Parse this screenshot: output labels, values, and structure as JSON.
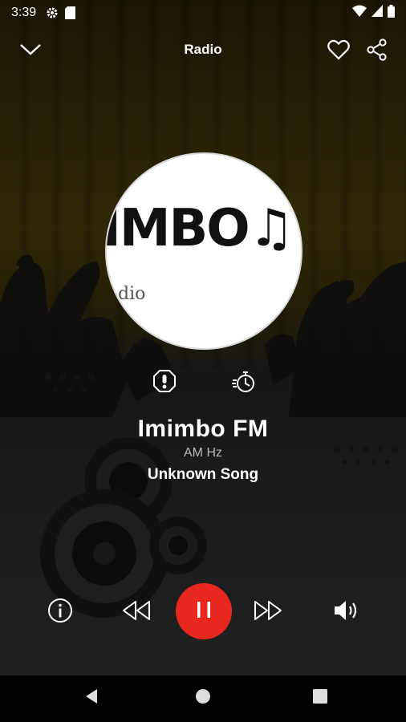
{
  "status_bar": {
    "time": "3:39",
    "icons": [
      "settings-icon",
      "sd-card-icon",
      "wifi-icon",
      "signal-icon",
      "battery-icon"
    ]
  },
  "app_bar": {
    "title": "Radio",
    "icons": [
      "chevron-down-icon",
      "heart-icon",
      "share-icon"
    ]
  },
  "artwork": {
    "logo_text": "IMBO♫",
    "logo_subtext": "dio"
  },
  "actions": {
    "icons": [
      "report-icon",
      "sleep-timer-icon"
    ]
  },
  "now_playing": {
    "station": "Imimbo FM",
    "frequency": "AM Hz",
    "song": "Unknown Song"
  },
  "controls": {
    "icons": [
      "info-icon",
      "rewind-icon",
      "pause-icon",
      "fast-forward-icon",
      "volume-icon"
    ],
    "play_button_color": "#e8271f"
  },
  "nav_bar": {
    "icons": [
      "back-icon",
      "home-icon",
      "recents-icon"
    ]
  }
}
